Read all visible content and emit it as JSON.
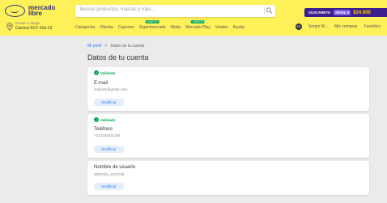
{
  "header": {
    "logo": {
      "line1": "mercado",
      "line2": "libre"
    },
    "search": {
      "placeholder": "Buscar productos, marcas y más..."
    },
    "promo": {
      "text": "SUSCRIBITE",
      "level": "NIVEL 6",
      "price": "$24.900"
    },
    "address": {
      "small": "Enviar a Sergio",
      "main": "Carrera 53 F #2a-13"
    },
    "nav": [
      {
        "label": "Categorías"
      },
      {
        "label": "Ofertas"
      },
      {
        "label": "Cupones"
      },
      {
        "label": "Supermercado",
        "badge": "NUEVO"
      },
      {
        "label": "Moda"
      },
      {
        "label": "Mercado Play",
        "badge": "GRATIS"
      },
      {
        "label": "Vender"
      },
      {
        "label": "Ayuda"
      }
    ],
    "user": {
      "initials": "SG",
      "name": "Sergio M...",
      "purchases": "Mis compras",
      "favorites": "Favoritos"
    }
  },
  "breadcrumb": {
    "link": "Mi perfil",
    "separator": ">",
    "current": "Datos de tu cuenta"
  },
  "page_title": "Datos de tu cuenta",
  "cards": {
    "email": {
      "status": "Validado",
      "label": "E-mail",
      "value": "segm31@gmail.com",
      "button": "Modificar"
    },
    "phone": {
      "status": "Validado",
      "label": "Teléfono",
      "value": "+573154831155",
      "button": "Modificar"
    },
    "username": {
      "label": "Nombre de usuario",
      "value": "SERGIO_JGUTAB",
      "button": "Modificar"
    }
  },
  "colors": {
    "header_bg": "#fff159",
    "accent": "#3483fa",
    "validated": "#00a650",
    "promo_bg": "#3c1f8c"
  }
}
